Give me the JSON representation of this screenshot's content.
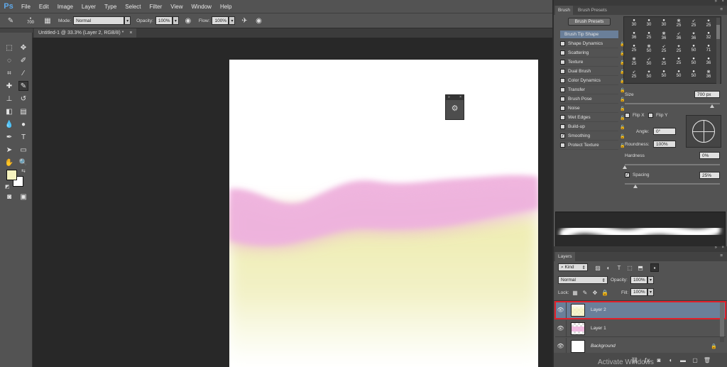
{
  "app": {
    "logo": "Ps"
  },
  "menu": [
    "File",
    "Edit",
    "Image",
    "Layer",
    "Type",
    "Select",
    "Filter",
    "View",
    "Window",
    "Help"
  ],
  "options_bar": {
    "brush_size": "700",
    "mode_label": "Mode:",
    "mode_value": "Normal",
    "opacity_label": "Opacity:",
    "opacity_value": "100%",
    "flow_label": "Flow:",
    "flow_value": "100%"
  },
  "document_tab": {
    "title": "Untitled-1 @ 33.3% (Layer 2, RGB/8) *",
    "close": "×"
  },
  "colors": {
    "foreground": "#f6f3bf",
    "background": "#ffffff",
    "accent_select": "#6a7f99",
    "highlight_border": "#e0202a"
  },
  "brush_panel": {
    "tabs": [
      "Brush",
      "Brush Presets"
    ],
    "presets_button": "Brush Presets",
    "options": [
      {
        "label": "Brush Tip Shape",
        "checkbox": false,
        "active": true
      },
      {
        "label": "Shape Dynamics",
        "checkbox": true,
        "checked": false
      },
      {
        "label": "Scattering",
        "checkbox": true,
        "checked": false
      },
      {
        "label": "Texture",
        "checkbox": true,
        "checked": false
      },
      {
        "label": "Dual Brush",
        "checkbox": true,
        "checked": false
      },
      {
        "label": "Color Dynamics",
        "checkbox": true,
        "checked": false
      },
      {
        "label": "Transfer",
        "checkbox": true,
        "checked": false
      },
      {
        "label": "Brush Pose",
        "checkbox": true,
        "checked": false
      },
      {
        "label": "Noise",
        "checkbox": true,
        "checked": false
      },
      {
        "label": "Wet Edges",
        "checkbox": true,
        "checked": false
      },
      {
        "label": "Build-up",
        "checkbox": true,
        "checked": false
      },
      {
        "label": "Smoothing",
        "checkbox": true,
        "checked": true
      },
      {
        "label": "Protect Texture",
        "checkbox": true,
        "checked": false
      }
    ],
    "tip_sizes": [
      [
        "30",
        "30",
        "30",
        "25",
        "25",
        "25"
      ],
      [
        "36",
        "25",
        "36",
        "36",
        "36",
        "32"
      ],
      [
        "25",
        "50",
        "25",
        "25",
        "50",
        "71"
      ],
      [
        "25",
        "50",
        "25",
        "25",
        "50",
        "36"
      ],
      [
        "25",
        "50",
        "50",
        "50",
        "50",
        "36"
      ]
    ],
    "size_label": "Size",
    "size_value": "700 px",
    "flip_x": "Flip X",
    "flip_y": "Flip Y",
    "angle_label": "Angle:",
    "angle_value": "0°",
    "roundness_label": "Roundness:",
    "roundness_value": "100%",
    "hardness_label": "Hardness",
    "hardness_value": "0%",
    "spacing_label": "Spacing",
    "spacing_value": "25%"
  },
  "layers_panel": {
    "title": "Layers",
    "kind_label": "Kind",
    "blend_mode": "Normal",
    "opacity_label": "Opacity:",
    "opacity_value": "100%",
    "lock_label": "Lock:",
    "fill_label": "Fill:",
    "fill_value": "100%",
    "layers": [
      {
        "name": "Layer 2",
        "selected": true
      },
      {
        "name": "Layer 1",
        "selected": false
      },
      {
        "name": "Background",
        "selected": false
      }
    ],
    "watermark": "Activate Windows"
  }
}
